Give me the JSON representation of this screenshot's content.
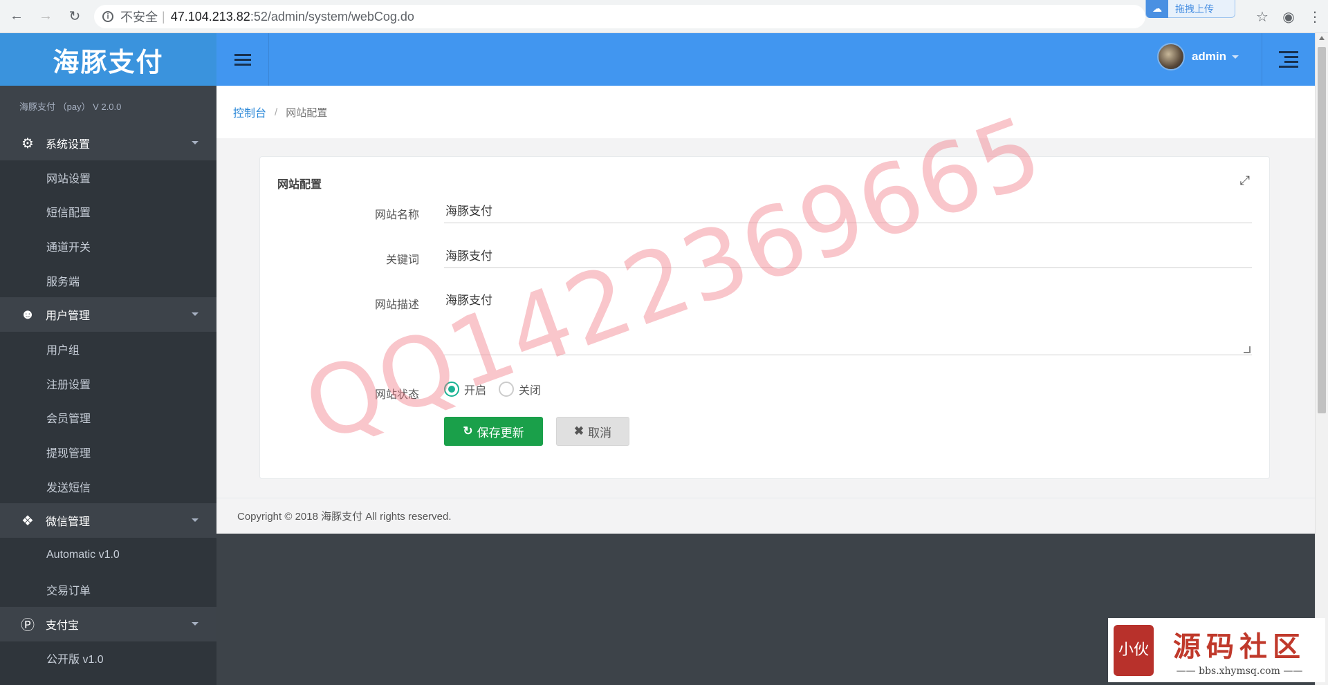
{
  "browser": {
    "security_label": "不安全",
    "url_host": "47.104.213.82",
    "url_path": ":52/admin/system/webCog.do",
    "upload_widget_label": "拖拽上传"
  },
  "sidebar": {
    "brand": "海豚支付",
    "version": "海豚支付 （pay） V 2.0.0",
    "sections": [
      {
        "title": "系统设置",
        "icon": "gear-icon",
        "items": [
          "网站设置",
          "短信配置",
          "通道开关",
          "服务端"
        ]
      },
      {
        "title": "用户管理",
        "icon": "user-icon",
        "items": [
          "用户组",
          "注册设置",
          "会员管理",
          "提现管理",
          "发送短信"
        ]
      },
      {
        "title": "微信管理",
        "icon": "wechat-icon",
        "items": [
          "Automatic v1.0",
          "交易订单"
        ]
      },
      {
        "title": "支付宝",
        "icon": "pinterest-icon",
        "items": [
          "公开版 v1.0"
        ]
      }
    ]
  },
  "header": {
    "username": "admin"
  },
  "breadcrumb": {
    "home": "控制台",
    "separator": "/",
    "current": "网站配置"
  },
  "panel": {
    "title": "网站配置",
    "fields": {
      "site_name_label": "网站名称",
      "site_name_value": "海豚支付",
      "keywords_label": "关键词",
      "keywords_value": "海豚支付",
      "description_label": "网站描述",
      "description_value": "海豚支付",
      "status_label": "网站状态",
      "status_on": "开启",
      "status_off": "关闭",
      "status_selected": "开启"
    },
    "buttons": {
      "save": "保存更新",
      "cancel": "取消"
    }
  },
  "footer": {
    "copyright": "Copyright © 2018 海豚支付 All rights reserved."
  },
  "overlay": {
    "watermark": "QQ1422369665",
    "logo_title": "源码社区",
    "logo_url": "—— bbs.xhymsq.com ——",
    "logo_seal": "小伙"
  },
  "colors": {
    "brand_blue": "#3a93dd",
    "topbar_blue": "#4196f0",
    "sidebar_dark": "#2f353b",
    "save_green": "#1aa04a",
    "radio_teal": "#1ab394",
    "link_blue": "#2b88d8"
  }
}
